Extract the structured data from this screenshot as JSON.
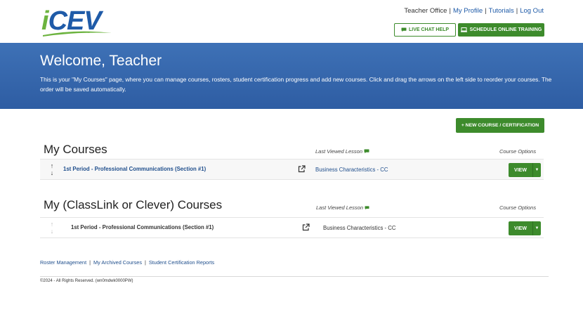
{
  "logo": {
    "text_i": "i",
    "text_rest": "CEV",
    "colors": {
      "i": "#6cb33f",
      "rest": "#1f5ba8"
    }
  },
  "top_links": [
    {
      "label": "Teacher Office",
      "link": false
    },
    {
      "label": "My Profile",
      "link": true
    },
    {
      "label": "Tutorials",
      "link": true
    },
    {
      "label": "Log Out",
      "link": true
    }
  ],
  "buttons": {
    "live_chat": "LIVE CHAT HELP",
    "schedule_training": "SCHEDULE ONLINE TRAINING",
    "new_course": "+ NEW COURSE / CERTIFICATION"
  },
  "banner": {
    "title": "Welcome, Teacher",
    "description": "This is your \"My Courses\" page, where you can manage courses, rosters, student certification progress and add new courses. Click and drag the arrows on the left side to reorder your courses. The order will be saved automatically."
  },
  "my_courses": {
    "title": "My Courses",
    "last_viewed_header": "Last Viewed Lesson",
    "options_header": "Course Options",
    "rows": [
      {
        "name": "1st Period - Professional Communications (Section #1)",
        "lesson": "Business Characteristics - CC",
        "view_label": "VIEW"
      }
    ]
  },
  "classlink_courses": {
    "title": "My (ClassLink or Clever) Courses",
    "last_viewed_header": "Last Viewed Lesson",
    "options_header": "Course Options",
    "rows": [
      {
        "name": "1st Period - Professional Communications (Section #1)",
        "lesson": "Business Characteristics - CC",
        "view_label": "VIEW"
      }
    ]
  },
  "footer": {
    "links": [
      "Roster Management",
      "My Archived Courses",
      "Student Certification Reports"
    ],
    "copyright": "©2024 - All Rights Reserved. (wn0mdwk0000PW)"
  },
  "colors": {
    "brand_blue": "#2e5da3",
    "accent_green": "#3d8b2c",
    "link_blue": "#1f4e8c"
  },
  "icons": [
    "chat-bubble-icon",
    "monitor-icon",
    "external-link-icon",
    "sort-arrows-icon",
    "chevron-down-icon"
  ]
}
